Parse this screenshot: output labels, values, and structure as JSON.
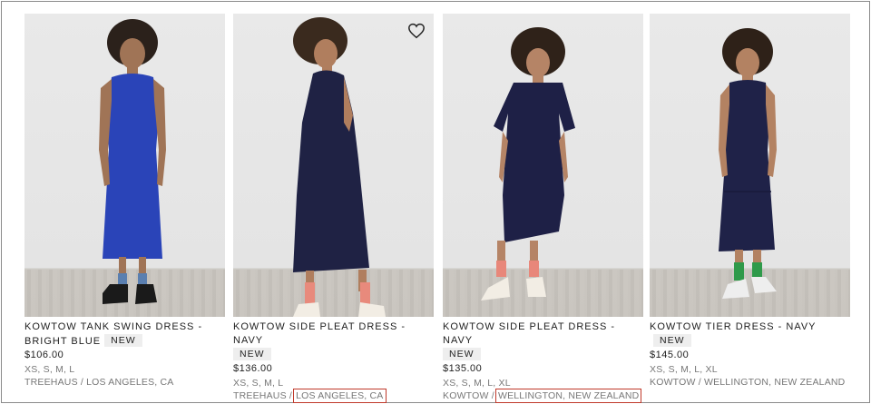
{
  "products": [
    {
      "title": "KOWTOW TANK SWING DRESS - BRIGHT BLUE",
      "badge": "NEW",
      "price": "$106.00",
      "sizes": "XS, S, M, L",
      "store": "TREEHAUS",
      "location": "LOS ANGELES, CA",
      "dress_color": "#2a44b8",
      "sock_color": "#5a7fb0",
      "shoe_color": "#1a1a1a"
    },
    {
      "title": "KOWTOW SIDE PLEAT DRESS - NAVY",
      "badge": "NEW",
      "price": "$136.00",
      "sizes": "XS, S, M, L",
      "store": "TREEHAUS",
      "location": "LOS ANGELES, CA",
      "dress_color": "#1f2244",
      "sock_color": "#e88a7c",
      "shoe_color": "#f2ede4",
      "wishlist_icon": "heart-outline-icon"
    },
    {
      "title": "KOWTOW SIDE PLEAT DRESS - NAVY",
      "badge": "NEW",
      "price": "$135.00",
      "sizes": "XS, S, M, L, XL",
      "store": "KOWTOW",
      "location": "WELLINGTON, NEW ZEALAND",
      "dress_color": "#1e2046",
      "sock_color": "#e8877a",
      "shoe_color": "#f2ede4"
    },
    {
      "title": "KOWTOW TIER DRESS - NAVY",
      "badge": "NEW",
      "price": "$145.00",
      "sizes": "XS, S, M, L, XL",
      "store": "KOWTOW",
      "location": "WELLINGTON, NEW ZEALAND",
      "dress_color": "#1f2248",
      "sock_color": "#2f9a4a",
      "shoe_color": "#eeeeee"
    }
  ],
  "separator": " / ",
  "highlight_color": "#c0392b"
}
